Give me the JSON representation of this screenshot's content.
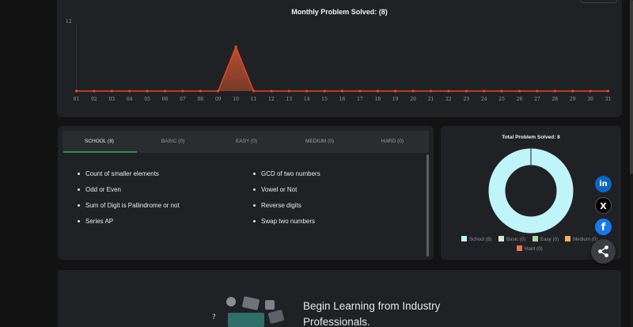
{
  "monthly_chart": {
    "title": "Monthly Problem Solved: (8)",
    "y_tick_label": "12",
    "colors": {
      "line": "#e8462b",
      "fill": "#c2502f"
    }
  },
  "chart_data": {
    "type": "area",
    "title": "Monthly Problem Solved: (8)",
    "x": [
      "01",
      "02",
      "03",
      "04",
      "05",
      "06",
      "07",
      "08",
      "09",
      "10",
      "11",
      "12",
      "13",
      "14",
      "15",
      "16",
      "17",
      "18",
      "19",
      "20",
      "21",
      "22",
      "23",
      "24",
      "25",
      "26",
      "27",
      "28",
      "29",
      "30",
      "31"
    ],
    "values": [
      0,
      0,
      0,
      0,
      0,
      0,
      0,
      0,
      0,
      8,
      0,
      0,
      0,
      0,
      0,
      0,
      0,
      0,
      0,
      0,
      0,
      0,
      0,
      0,
      0,
      0,
      0,
      0,
      0,
      0,
      0
    ],
    "ylim": [
      0,
      12
    ],
    "xlabel": "",
    "ylabel": "",
    "grid": false
  },
  "tabs": [
    {
      "label": "SCHOOL (8)",
      "active": true
    },
    {
      "label": "BASIC (0)",
      "active": false
    },
    {
      "label": "EASY (0)",
      "active": false
    },
    {
      "label": "MEDIUM (0)",
      "active": false
    },
    {
      "label": "HARD (0)",
      "active": false
    }
  ],
  "problems": {
    "left": [
      "Count of smaller elements",
      "Odd or Even",
      "Sum of Digit is Pallindrome or not",
      "Series AP"
    ],
    "right": [
      "GCD of two numbers",
      "Vowel or Not",
      "Reverse digits",
      "Swap two numbers"
    ]
  },
  "donut": {
    "title": "Total Problem Solved: 8",
    "legend": [
      {
        "label": "School (8)",
        "color": "#bff4f8"
      },
      {
        "label": "Basic (0)",
        "color": "#d8ecc8"
      },
      {
        "label": "Easy (0)",
        "color": "#a8d8a0"
      },
      {
        "label": "Medium (0)",
        "color": "#f2b063"
      },
      {
        "label": "Hard (0)",
        "color": "#ec7155"
      }
    ]
  },
  "social": {
    "linkedin": "in",
    "x": "X",
    "facebook": "f"
  },
  "banner": {
    "line1": "Begin Learning from Industry",
    "line2": "Professionals."
  }
}
